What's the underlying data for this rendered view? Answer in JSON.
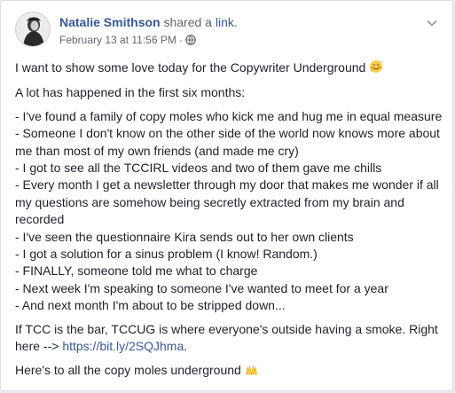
{
  "post": {
    "author": "Natalie Smithson",
    "action": "shared a",
    "action_link": "link",
    "action_end": ".",
    "timestamp": "February 13 at 11:56 PM",
    "separator": "·",
    "privacy_icon": "globe-icon",
    "options_icon": "chevron-down-icon",
    "intro": "I want to show some love today for the Copywriter Underground",
    "intro_emoji": "smiling-face-with-hearts-emoji",
    "lead": "A lot has happened in the first six months:",
    "list": [
      "- I've found a family of copy moles who kick me and hug me in equal measure",
      "- Someone I don't know on the other side of the world now knows more about me than most of my own friends (and made me cry)",
      "- I got to see all the TCCIRL videos and two of them gave me chills",
      "- Every month I get a newsletter through my door that makes me wonder if all my questions are somehow being secretly extracted from my brain and recorded",
      "- I've seen the questionnaire Kira sends out to her own clients",
      "- I got a solution for a sinus problem (I know! Random.)",
      "- FINALLY, someone told me what to charge",
      "- Next week I'm speaking to someone I've wanted to meet for a year",
      "- And next month I'm about to be stripped down..."
    ],
    "closing_text": "If TCC is the bar, TCCUG is where everyone's outside having a smoke. Right here -->",
    "closing_link": "https://bit.ly/2SQJhma",
    "closing_end": ".",
    "signoff": "Here's to all the copy moles underground",
    "signoff_emoji": "raising-hands-emoji"
  },
  "colors": {
    "link": "#365899",
    "text": "#1d2129",
    "meta": "#616770",
    "background": "#ffffff"
  }
}
